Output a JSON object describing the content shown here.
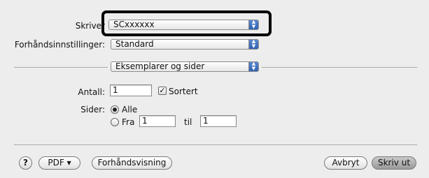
{
  "printer": {
    "label": "Skriver",
    "value": "SCxxxxxx"
  },
  "presets": {
    "label": "Forhåndsinnstillinger:",
    "value": "Standard"
  },
  "section": {
    "value": "Eksemplarer og sider"
  },
  "copies": {
    "label": "Antall:",
    "value": "1",
    "collate_label": "Sortert",
    "collate_checked": true
  },
  "pages": {
    "label": "Sider:",
    "all_label": "Alle",
    "from_label": "Fra",
    "from_value": "1",
    "to_label": "til",
    "to_value": "1"
  },
  "footer": {
    "help_label": "?",
    "pdf_label": "PDF ▾",
    "preview_label": "Forhåndsvisning",
    "cancel_label": "Avbryt",
    "print_label": "Skriv ut"
  },
  "icons": {
    "popup_arrows": "updown-arrows-icon",
    "check": "check-icon"
  },
  "colors": {
    "accent": "#2d5fb0",
    "panel": "#ededed",
    "highlight": "#000000"
  }
}
